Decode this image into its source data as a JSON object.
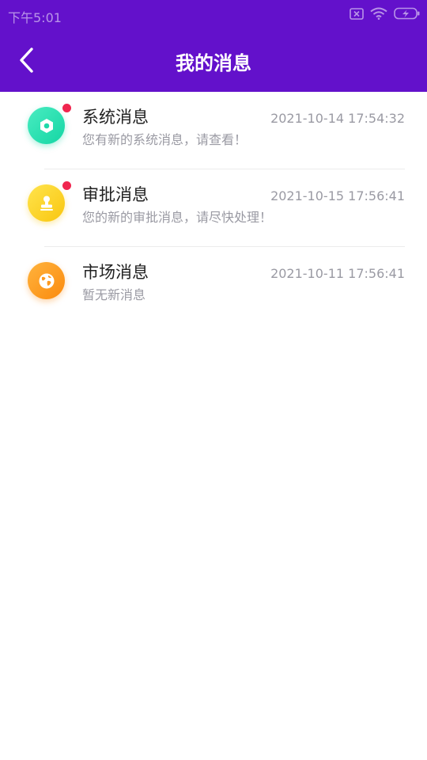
{
  "status_bar": {
    "time": "下午5:01",
    "icons": [
      "sim-off-icon",
      "wifi-icon",
      "battery-charging-icon"
    ]
  },
  "header": {
    "title": "我的消息",
    "back_icon": "chevron-left-icon",
    "background": "#6311CB"
  },
  "messages": [
    {
      "title": "系统消息",
      "preview": "您有新的系统消息，请查看！",
      "time": "2021-10-14 17:54:32",
      "icon": "hexagon-nut-icon",
      "unread": true,
      "color": "#1ED9AA"
    },
    {
      "title": "审批消息",
      "preview": "您的新的审批消息，请尽快处理！",
      "time": "2021-10-15 17:56:41",
      "icon": "stamp-icon",
      "unread": true,
      "color": "#FBD020"
    },
    {
      "title": "市场消息",
      "preview": "暂无新消息",
      "time": "2021-10-11 17:56:41",
      "icon": "globe-icon",
      "unread": false,
      "color": "#FD9A20"
    }
  ],
  "colors": {
    "unread_dot": "#F0264F",
    "title_text": "#222222",
    "secondary_text": "#9A9AA3"
  }
}
